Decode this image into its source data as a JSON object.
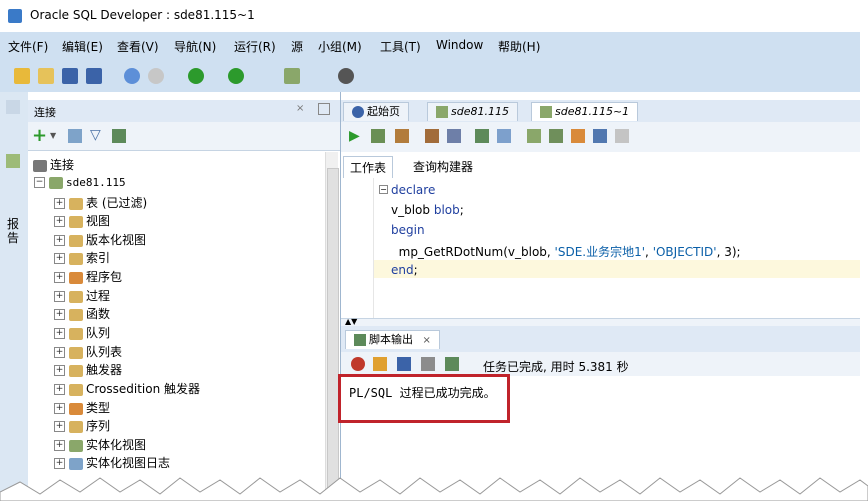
{
  "window": {
    "title": "Oracle SQL Developer : sde81.115~1"
  },
  "menu": [
    "文件(F)",
    "编辑(E)",
    "查看(V)",
    "导航(N)",
    "运行(R)",
    "源",
    "小组(M)",
    "工具(T)",
    "Window",
    "帮助(H)"
  ],
  "left_strip": {
    "label": "报告"
  },
  "connections": {
    "header": "连接",
    "root": "连接",
    "connection": "sde81.115",
    "items": [
      "表 (已过滤)",
      "视图",
      "版本化视图",
      "索引",
      "程序包",
      "过程",
      "函数",
      "队列",
      "队列表",
      "触发器",
      "Crossedition 触发器",
      "类型",
      "序列",
      "实体化视图",
      "实体化视图日志"
    ]
  },
  "editor_tabs": [
    "起始页",
    "sde81.115",
    "sde81.115~1"
  ],
  "worksheet_tabs": [
    "工作表",
    "查询构建器"
  ],
  "code": {
    "line1": "declare",
    "line2a": "v_blob ",
    "line2b": "blob",
    "line2c": ";",
    "line3": "begin",
    "line4a": "  mp_GetRDotNum(v_blob, ",
    "line4b": "'SDE.业务宗地1'",
    "line4c": ", ",
    "line4d": "'OBJECTID'",
    "line4e": ", 3);",
    "line5a": "end",
    "line5b": ";"
  },
  "output": {
    "tab": "脚本输出",
    "tab_close": "×",
    "status": "任务已完成, 用时 5.381 秒",
    "message": "PL/SQL 过程已成功完成。"
  },
  "colors": {
    "accent_red": "#c0232b",
    "menu_bg": "#cfe0f1"
  }
}
